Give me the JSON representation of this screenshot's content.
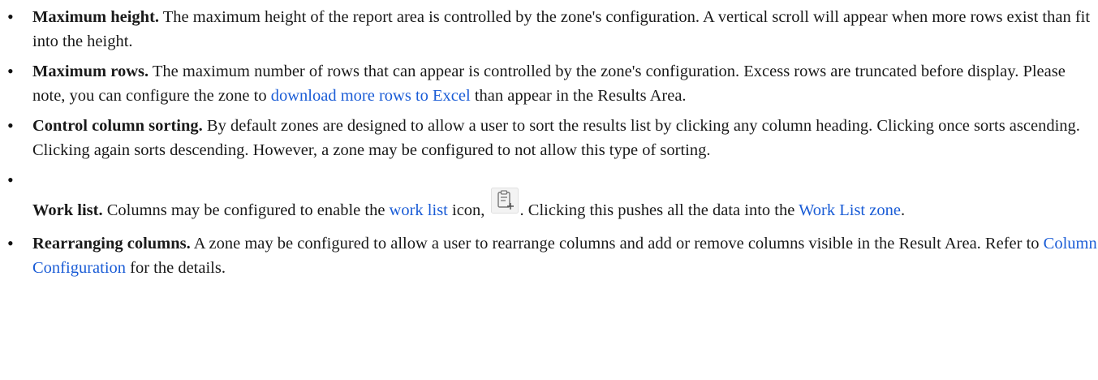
{
  "bullets": [
    {
      "term": "Maximum height.",
      "text": " The maximum height of the report area is controlled by the zone's configuration. A vertical scroll will appear when more rows exist than fit into the height."
    },
    {
      "term": "Maximum rows.",
      "text_before": " The maximum number of rows that can appear is controlled by the zone's configuration. Excess rows are truncated before display. Please note, you can configure the zone to ",
      "link": "download more rows to Excel",
      "text_after": " than appear in the Results Area."
    },
    {
      "term": "Control column sorting.",
      "text": " By default zones are designed to allow a user to sort the results list by clicking any column heading. Clicking once sorts ascending. Clicking again sorts descending. However, a zone may be configured to not allow this type of sorting."
    },
    {
      "term": "Work list.",
      "text_before": " Columns may be configured to enable the ",
      "link1": "work list",
      "text_mid": " icon, ",
      "icon": "clipboard-add-icon",
      "text_after_icon": ". Clicking this pushes all the data into the ",
      "link2": "Work List zone",
      "text_end": "."
    },
    {
      "term": "Rearranging columns.",
      "text_before": " A zone may be configured to allow a user to rearrange columns and add or remove columns visible in the Result Area. Refer to ",
      "link": "Column Configuration",
      "text_after": " for the details."
    }
  ]
}
